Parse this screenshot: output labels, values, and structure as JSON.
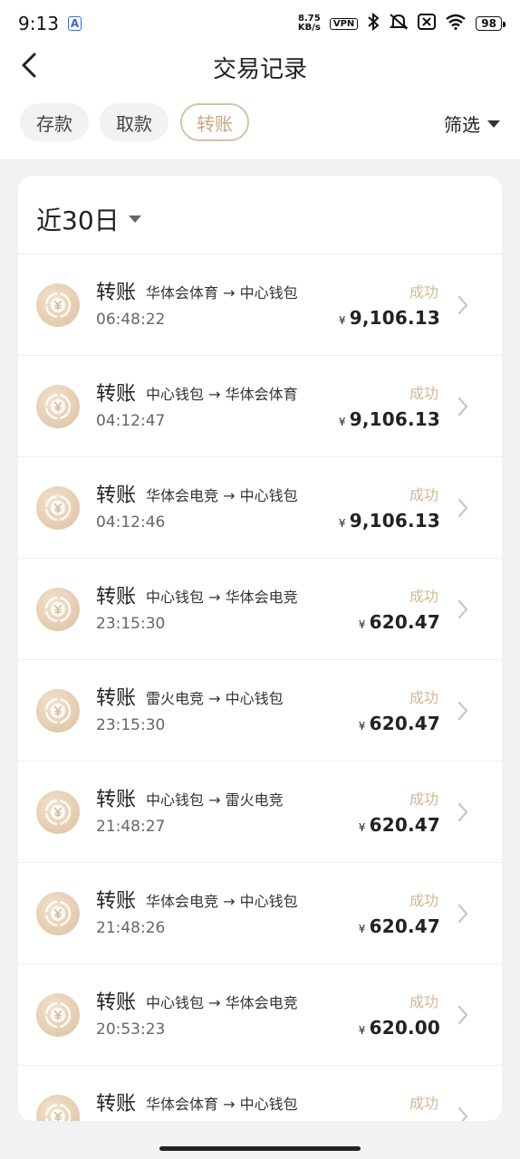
{
  "status_bar": {
    "time": "9:13",
    "badge": "A",
    "speed_value": "8.75",
    "speed_unit": "KB/s",
    "vpn": "VPN",
    "battery": "98"
  },
  "header": {
    "title": "交易记录"
  },
  "tabs": [
    {
      "label": "存款"
    },
    {
      "label": "取款"
    },
    {
      "label": "转账"
    }
  ],
  "filter_label": "筛选",
  "range_label": "近30日",
  "colors": {
    "accent": "#c6a982",
    "status_success": "#d3b792"
  },
  "transactions": [
    {
      "type": "转账",
      "route": "华体会体育 → 中心钱包",
      "time": "06:48:22",
      "status": "成功",
      "currency": "¥",
      "amount": "9,106.13"
    },
    {
      "type": "转账",
      "route": "中心钱包 → 华体会体育",
      "time": "04:12:47",
      "status": "成功",
      "currency": "¥",
      "amount": "9,106.13"
    },
    {
      "type": "转账",
      "route": "华体会电竞 → 中心钱包",
      "time": "04:12:46",
      "status": "成功",
      "currency": "¥",
      "amount": "9,106.13"
    },
    {
      "type": "转账",
      "route": "中心钱包 → 华体会电竞",
      "time": "23:15:30",
      "status": "成功",
      "currency": "¥",
      "amount": "620.47"
    },
    {
      "type": "转账",
      "route": "雷火电竞 → 中心钱包",
      "time": "23:15:30",
      "status": "成功",
      "currency": "¥",
      "amount": "620.47"
    },
    {
      "type": "转账",
      "route": "中心钱包 → 雷火电竞",
      "time": "21:48:27",
      "status": "成功",
      "currency": "¥",
      "amount": "620.47"
    },
    {
      "type": "转账",
      "route": "华体会电竞 → 中心钱包",
      "time": "21:48:26",
      "status": "成功",
      "currency": "¥",
      "amount": "620.47"
    },
    {
      "type": "转账",
      "route": "中心钱包 → 华体会电竞",
      "time": "20:53:23",
      "status": "成功",
      "currency": "¥",
      "amount": "620.00"
    },
    {
      "type": "转账",
      "route": "华体会体育 → 中心钱包",
      "time": "",
      "status": "成功",
      "currency": "",
      "amount": ""
    }
  ]
}
